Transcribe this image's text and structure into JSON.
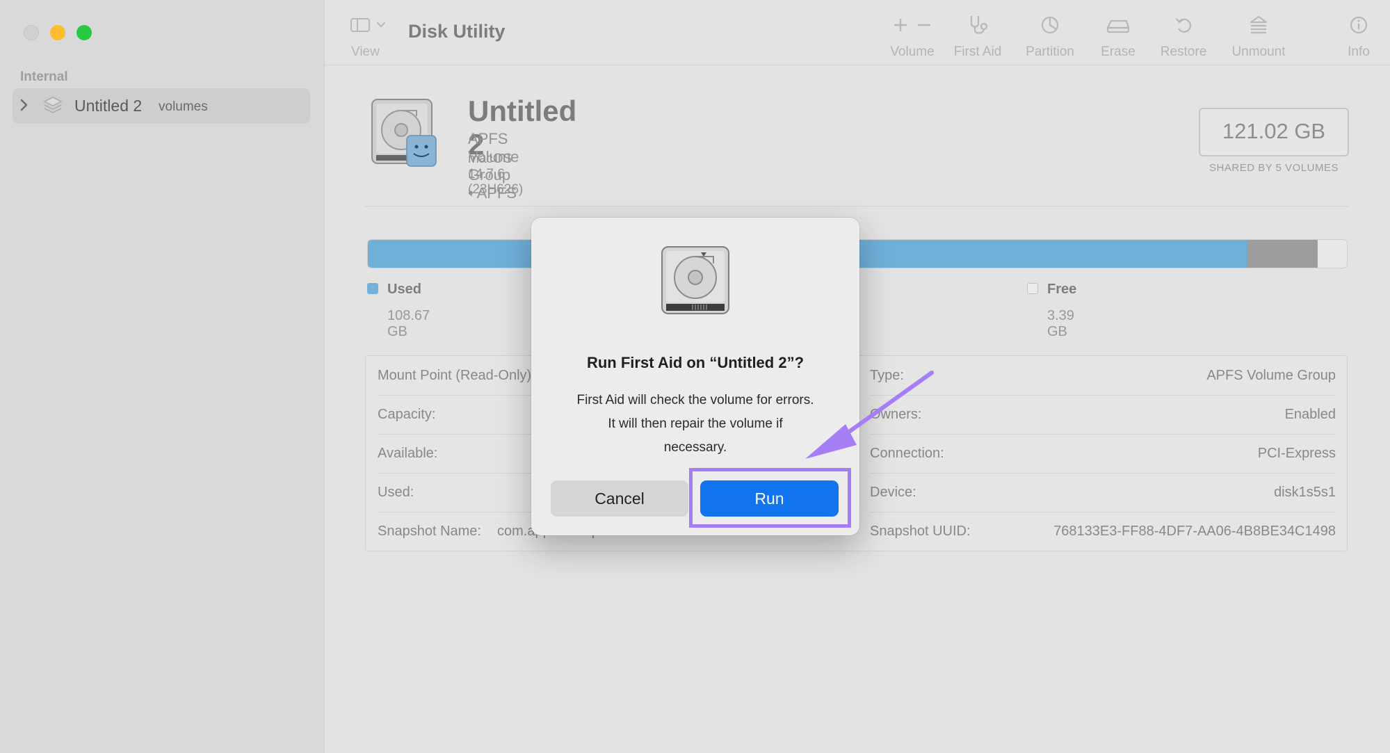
{
  "window": {
    "app_title": "Disk Utility"
  },
  "sidebar": {
    "section_label": "Internal",
    "items": [
      {
        "name": "Untitled 2",
        "sub": "volumes",
        "icon": "stack-layers-icon"
      }
    ]
  },
  "toolbar": {
    "view_label": "View",
    "volume_label": "Volume",
    "first_aid_label": "First Aid",
    "partition_label": "Partition",
    "erase_label": "Erase",
    "restore_label": "Restore",
    "unmount_label": "Unmount",
    "info_label": "Info"
  },
  "volume": {
    "name": "Untitled 2",
    "type_line": "APFS Volume Group • APFS",
    "os_line": "macOS 14.7.6 (23H626)",
    "size": "121.02 GB",
    "size_caption": "SHARED BY 5 VOLUMES"
  },
  "usage": {
    "used_label": "Used",
    "used_value": "108.67 GB",
    "free_label": "Free",
    "free_value": "3.39 GB",
    "used_fraction": 0.898,
    "other_fraction": 0.072,
    "used_color": "#6fb0d9",
    "other_color": "#9d9d9d"
  },
  "info": {
    "left": [
      {
        "key": "Mount Point (Read-Only):",
        "value": ""
      },
      {
        "key": "Capacity:",
        "value": ""
      },
      {
        "key": "Available:",
        "value": ""
      },
      {
        "key": "Used:",
        "value": ""
      },
      {
        "key": "Snapshot Name:",
        "value": "com.apple.os.update-C6CF2CA5B36F8C5C1B2F76..."
      }
    ],
    "right": [
      {
        "key": "Type:",
        "value": "APFS Volume Group"
      },
      {
        "key": "Owners:",
        "value": "Enabled"
      },
      {
        "key": "Connection:",
        "value": "PCI-Express"
      },
      {
        "key": "Device:",
        "value": "disk1s5s1"
      },
      {
        "key": "Snapshot UUID:",
        "value": "768133E3-FF88-4DF7-AA06-4B8BE34C1498"
      }
    ]
  },
  "dialog": {
    "title": "Run First Aid on “Untitled 2”?",
    "message_lines": [
      "First Aid will check the volume for errors.",
      "It will then repair the volume if",
      "necessary."
    ],
    "cancel_label": "Cancel",
    "run_label": "Run"
  },
  "annotation": {
    "highlight_color": "#a57ef5"
  }
}
